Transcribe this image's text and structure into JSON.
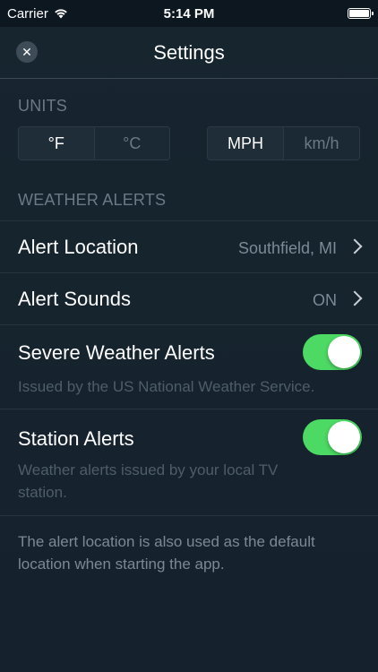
{
  "status_bar": {
    "carrier": "Carrier",
    "time": "5:14 PM"
  },
  "header": {
    "title": "Settings",
    "close_icon": "close-icon"
  },
  "units": {
    "section_label": "UNITS",
    "temperature": {
      "options": [
        "°F",
        "°C"
      ],
      "selected": "°F"
    },
    "speed": {
      "options": [
        "MPH",
        "km/h"
      ],
      "selected": "MPH"
    }
  },
  "weather_alerts": {
    "section_label": "WEATHER ALERTS",
    "alert_location": {
      "label": "Alert Location",
      "value": "Southfield, MI"
    },
    "alert_sounds": {
      "label": "Alert Sounds",
      "value": "ON"
    },
    "severe": {
      "label": "Severe Weather Alerts",
      "description": "Issued by the US National Weather Service.",
      "enabled": true
    },
    "station": {
      "label": "Station Alerts",
      "description": "Weather alerts issued by your local TV station.",
      "enabled": true
    }
  },
  "footer": {
    "note": "The alert location is also used as the default location when starting the app."
  },
  "colors": {
    "background": "#16232f",
    "toggle_on": "#4cd964",
    "muted_text": "#6a7985"
  }
}
